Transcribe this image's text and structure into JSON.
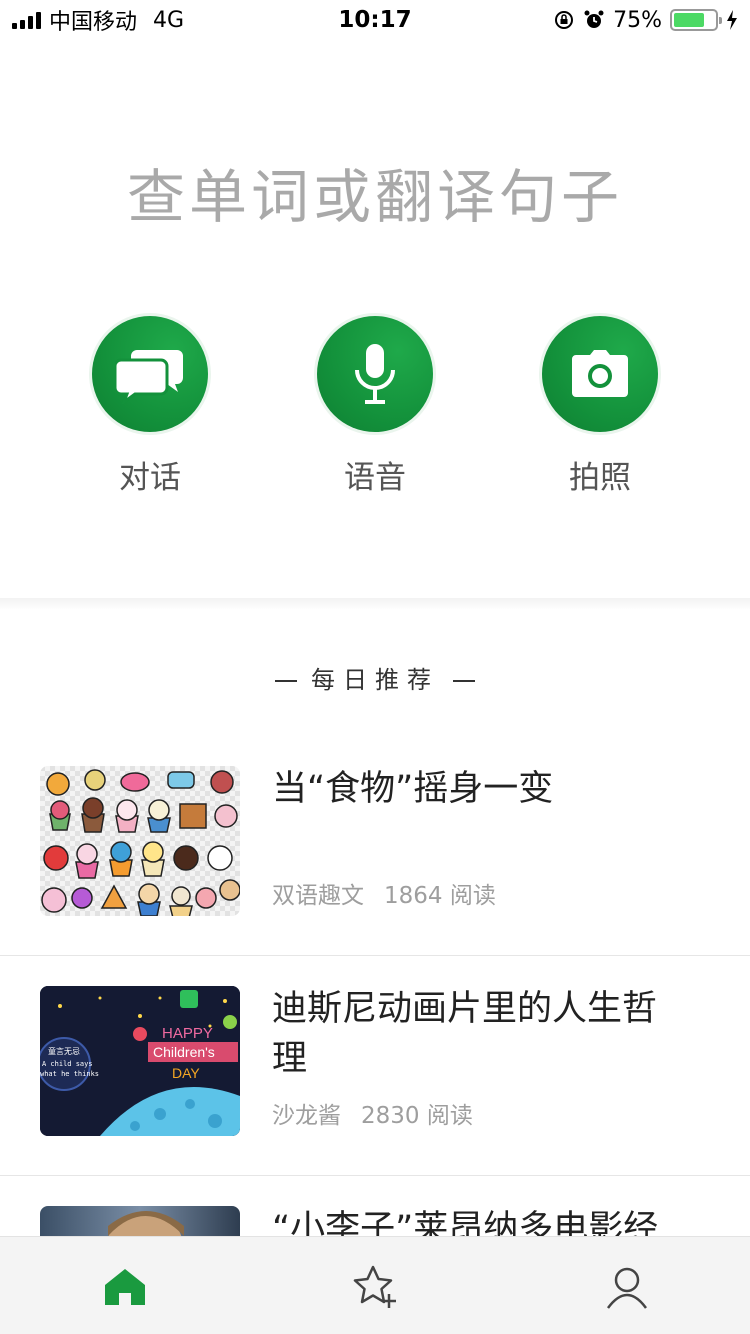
{
  "status_bar": {
    "carrier": "中国移动",
    "network": "4G",
    "time": "10:17",
    "battery_percent": "75%",
    "battery_level": 0.75
  },
  "search": {
    "placeholder": "查单词或翻译句子"
  },
  "actions": [
    {
      "label": "对话",
      "icon": "chat-bubbles-icon"
    },
    {
      "label": "语音",
      "icon": "microphone-icon"
    },
    {
      "label": "拍照",
      "icon": "camera-icon"
    }
  ],
  "daily": {
    "title": "每日推荐"
  },
  "articles": [
    {
      "title": "当“食物”摇身一变",
      "source": "双语趣文",
      "reads": "1864 阅读"
    },
    {
      "title": "迪斯尼动画片里的人生哲理",
      "source": "沙龙酱",
      "reads": "2830 阅读"
    },
    {
      "title": "“小李子”莱昂纳多电影经"
    }
  ],
  "thumb2": {
    "caption_line1": "童言无忌",
    "caption_line2": "A child says",
    "caption_line3": "what he thinks",
    "banner1": "HAPPY",
    "banner2": "Children's",
    "banner3": "DAY"
  },
  "tabbar": {
    "items": [
      "home-icon",
      "favorites-add-icon",
      "profile-icon"
    ],
    "active_color": "#1a9a3f"
  },
  "colors": {
    "accent": "#13913b",
    "muted_text": "#9e9e9e"
  }
}
